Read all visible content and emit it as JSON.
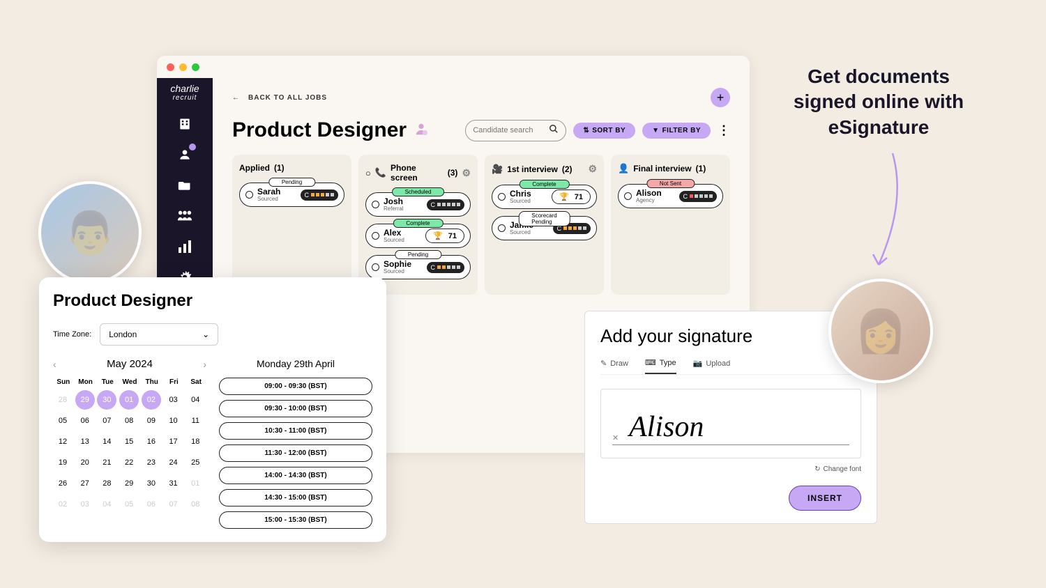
{
  "brand": {
    "name": "charlie",
    "sub": "recruit"
  },
  "back_label": "BACK TO ALL JOBS",
  "page_title": "Product Designer",
  "search": {
    "placeholder": "Candidate search"
  },
  "sort_label": "SORT BY",
  "filter_label": "FILTER BY",
  "columns": [
    {
      "title": "Applied",
      "count": "(1)"
    },
    {
      "title": "Phone screen",
      "count": "(3)"
    },
    {
      "title": "1st interview",
      "count": "(2)"
    },
    {
      "title": "Final interview",
      "count": "(1)"
    }
  ],
  "cards": {
    "sarah": {
      "name": "Sarah",
      "sub": "Sourced",
      "status": "Pending"
    },
    "josh": {
      "name": "Josh",
      "sub": "Referral",
      "status": "Scheduled"
    },
    "alex": {
      "name": "Alex",
      "sub": "Sourced",
      "status": "Complete",
      "score": "71"
    },
    "sophie": {
      "name": "Sophie",
      "sub": "Sourced",
      "status": "Pending"
    },
    "chris": {
      "name": "Chris",
      "sub": "Sourced",
      "status": "Complete",
      "score": "71"
    },
    "jamie": {
      "name": "Jamie",
      "sub": "Sourced",
      "status": "Scorecard Pending"
    },
    "alison": {
      "name": "Alison",
      "sub": "Agency",
      "status": "Not Sent"
    }
  },
  "calendar": {
    "title": "Product Designer",
    "tz_label": "Time Zone:",
    "tz_value": "London",
    "month": "May 2024",
    "weekdays": [
      "Sun",
      "Mon",
      "Tue",
      "Wed",
      "Thu",
      "Fri",
      "Sat"
    ],
    "date_heading": "Monday 29th April",
    "slots": [
      "09:00 - 09:30 (BST)",
      "09:30 - 10:00 (BST)",
      "10:30 - 11:00 (BST)",
      "11:30 - 12:00 (BST)",
      "14:00 - 14:30 (BST)",
      "14:30 - 15:00 (BST)",
      "15:00 - 15:30 (BST)"
    ],
    "days_row0": [
      "28",
      "29",
      "30",
      "01",
      "02",
      "03",
      "04"
    ],
    "days_row1": [
      "05",
      "06",
      "07",
      "08",
      "09",
      "10",
      "11"
    ],
    "days_row2": [
      "12",
      "13",
      "14",
      "15",
      "16",
      "17",
      "18"
    ],
    "days_row3": [
      "19",
      "20",
      "21",
      "22",
      "23",
      "24",
      "25"
    ],
    "days_row4": [
      "26",
      "27",
      "28",
      "29",
      "30",
      "31",
      "01"
    ],
    "days_row5": [
      "02",
      "03",
      "04",
      "05",
      "06",
      "07",
      "08"
    ]
  },
  "signature": {
    "title": "Add your signature",
    "tabs": {
      "draw": "Draw",
      "type": "Type",
      "upload": "Upload"
    },
    "value": "Alison",
    "change_font": "Change font",
    "insert": "INSERT"
  },
  "headline": "Get documents signed online with eSignature"
}
